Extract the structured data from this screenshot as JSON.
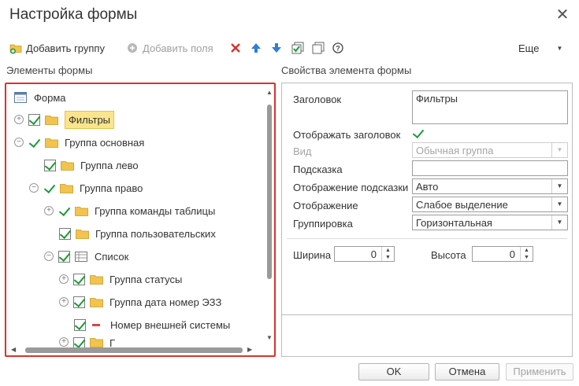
{
  "window": {
    "title": "Настройка формы"
  },
  "toolbar": {
    "add_group": "Добавить группу",
    "add_fields": "Добавить поля",
    "more": "Еще"
  },
  "left_panel": {
    "title": "Элементы формы"
  },
  "right_panel": {
    "title": "Свойства элемента формы"
  },
  "tree": {
    "items": [
      {
        "label": "Форма"
      },
      {
        "label": "Фильтры"
      },
      {
        "label": "Группа основная"
      },
      {
        "label": "Группа лево"
      },
      {
        "label": "Группа право"
      },
      {
        "label": "Группа команды таблицы"
      },
      {
        "label": "Группа пользовательских"
      },
      {
        "label": "Список"
      },
      {
        "label": "Группа статусы"
      },
      {
        "label": "Группа дата номер ЭЗЗ"
      },
      {
        "label": "Номер внешней системы"
      },
      {
        "label": "Г"
      }
    ]
  },
  "props": {
    "header_label": "Заголовок",
    "header_value": "Фильтры",
    "show_header_label": "Отображать заголовок",
    "view_label": "Вид",
    "view_value": "Обычная группа",
    "hint_label": "Подсказка",
    "hint_value": "",
    "hint_display_label": "Отображение подсказки",
    "hint_display_value": "Авто",
    "display_label": "Отображение",
    "display_value": "Слабое выделение",
    "grouping_label": "Группировка",
    "grouping_value": "Горизонтальная",
    "width_label": "Ширина",
    "width_value": "0",
    "height_label": "Высота",
    "height_value": "0"
  },
  "buttons": {
    "ok": "OK",
    "cancel": "Отмена",
    "apply": "Применить"
  },
  "colors": {
    "accent_red": "#d9332b",
    "check_green": "#1d9a3a",
    "folder_yellow": "#f2c34e",
    "highlight": "#fbe58c"
  }
}
